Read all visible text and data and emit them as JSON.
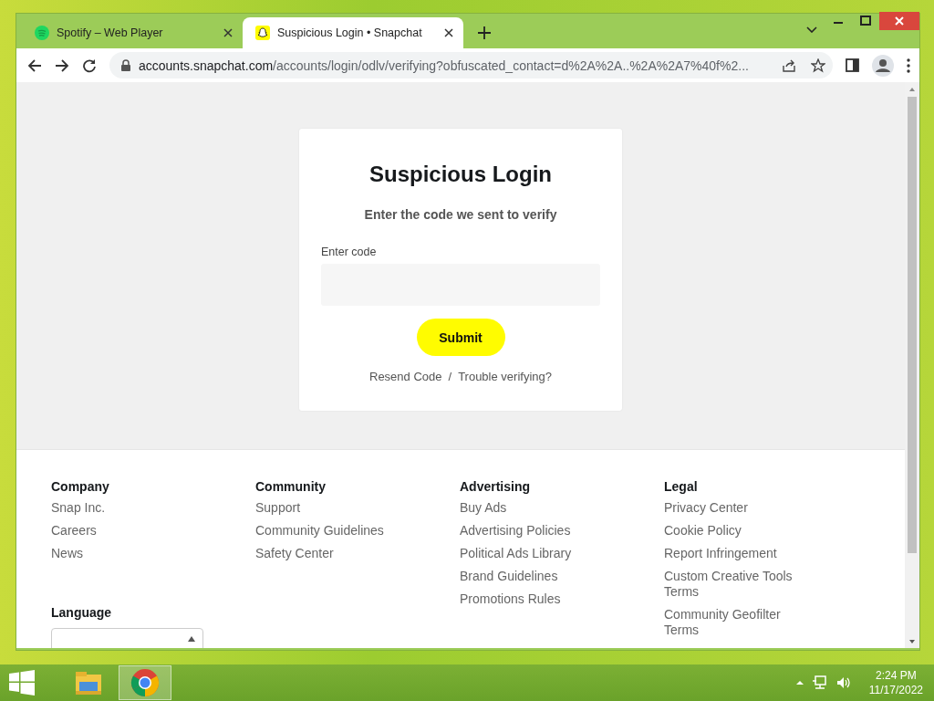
{
  "browser": {
    "tabs": [
      {
        "title": "Spotify – Web Player",
        "selected": false,
        "kind": "spotify"
      },
      {
        "title": "Suspicious Login • Snapchat",
        "selected": true,
        "kind": "snapchat"
      }
    ],
    "url_host": "accounts.snapchat.com",
    "url_path": "/accounts/login/odlv/verifying?obfuscated_contact=d%2A%2A..%2A%2A7%40f%2..."
  },
  "login": {
    "title": "Suspicious Login",
    "subtitle": "Enter the code we sent to verify",
    "field_label": "Enter code",
    "submit": "Submit",
    "links": [
      "Resend Code",
      "Trouble verifying?"
    ],
    "separator": "/"
  },
  "footer": {
    "columns": [
      {
        "heading": "Company",
        "links": [
          "Snap Inc.",
          "Careers",
          "News"
        ]
      },
      {
        "heading": "Community",
        "links": [
          "Support",
          "Community Guidelines",
          "Safety Center"
        ]
      },
      {
        "heading": "Advertising",
        "links": [
          "Buy Ads",
          "Advertising Policies",
          "Political Ads Library",
          "Brand Guidelines",
          "Promotions Rules"
        ]
      },
      {
        "heading": "Legal",
        "links": [
          "Privacy Center",
          "Cookie Policy",
          "Report Infringement",
          "Custom Creative Tools Terms",
          "Community Geofilter Terms"
        ]
      }
    ],
    "language_heading": "Language"
  },
  "taskbar": {
    "apps": [
      {
        "kind": "explorer",
        "selected": false
      },
      {
        "kind": "chrome",
        "selected": true
      }
    ],
    "time": "2:24 PM",
    "date": "11/17/2022"
  }
}
